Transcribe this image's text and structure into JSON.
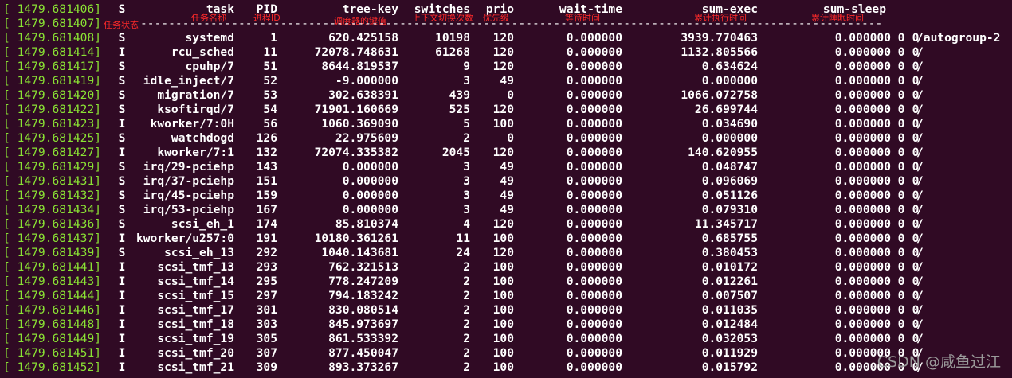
{
  "theme": {
    "background": "#300a24",
    "foreground": "#ffffff",
    "timestamp_color": "#8ae234",
    "annotation_color": "#ff2a2a",
    "watermark_color": "#9a9a9a"
  },
  "header": {
    "timestamp": "1479.681406",
    "columns": {
      "s": "S",
      "task": "task",
      "pid": "PID",
      "tree_key": "tree-key",
      "switches": "switches",
      "prio": "prio",
      "wait_time": "wait-time",
      "sum_exec": "sum-exec",
      "sum_sleep": "sum-sleep"
    }
  },
  "separator": {
    "timestamp": "1479.681407",
    "dashes": "--------------------------------------------------------------------------------------------------------------"
  },
  "annotations": {
    "s": "任务状态",
    "task": "任务名称",
    "pid": "进程ID",
    "tree_key": "调度器的键值",
    "switches": "上下文切换次数",
    "prio": "优先级",
    "wait_time": "等待时间",
    "sum_exec": "累计执行时间",
    "sum_sleep": "累计睡眠时间"
  },
  "rows": [
    {
      "ts": "1479.681408",
      "s": "S",
      "task": "systemd",
      "pid": "1",
      "tree_key": "620.425158",
      "switches": "10198",
      "prio": "120",
      "wait": "0.000000",
      "exec": "3939.770463",
      "sleep": "0.000000",
      "z1": "0",
      "z2": "0",
      "group": "/autogroup-2"
    },
    {
      "ts": "1479.681414",
      "s": "I",
      "task": "rcu_sched",
      "pid": "11",
      "tree_key": "72078.748631",
      "switches": "61268",
      "prio": "120",
      "wait": "0.000000",
      "exec": "1132.805566",
      "sleep": "0.000000",
      "z1": "0",
      "z2": "0",
      "group": "/"
    },
    {
      "ts": "1479.681417",
      "s": "S",
      "task": "cpuhp/7",
      "pid": "51",
      "tree_key": "8644.819537",
      "switches": "9",
      "prio": "120",
      "wait": "0.000000",
      "exec": "0.634624",
      "sleep": "0.000000",
      "z1": "0",
      "z2": "0",
      "group": "/"
    },
    {
      "ts": "1479.681419",
      "s": "S",
      "task": "idle_inject/7",
      "pid": "52",
      "tree_key": "-9.000000",
      "switches": "3",
      "prio": "49",
      "wait": "0.000000",
      "exec": "0.000000",
      "sleep": "0.000000",
      "z1": "0",
      "z2": "0",
      "group": "/"
    },
    {
      "ts": "1479.681420",
      "s": "S",
      "task": "migration/7",
      "pid": "53",
      "tree_key": "302.638391",
      "switches": "439",
      "prio": "0",
      "wait": "0.000000",
      "exec": "1066.072758",
      "sleep": "0.000000",
      "z1": "0",
      "z2": "0",
      "group": "/"
    },
    {
      "ts": "1479.681422",
      "s": "S",
      "task": "ksoftirqd/7",
      "pid": "54",
      "tree_key": "71901.160669",
      "switches": "525",
      "prio": "120",
      "wait": "0.000000",
      "exec": "26.699744",
      "sleep": "0.000000",
      "z1": "0",
      "z2": "0",
      "group": "/"
    },
    {
      "ts": "1479.681423",
      "s": "I",
      "task": "kworker/7:0H",
      "pid": "56",
      "tree_key": "1060.369090",
      "switches": "5",
      "prio": "100",
      "wait": "0.000000",
      "exec": "0.034690",
      "sleep": "0.000000",
      "z1": "0",
      "z2": "0",
      "group": "/"
    },
    {
      "ts": "1479.681425",
      "s": "S",
      "task": "watchdogd",
      "pid": "126",
      "tree_key": "22.975609",
      "switches": "2",
      "prio": "0",
      "wait": "0.000000",
      "exec": "0.000000",
      "sleep": "0.000000",
      "z1": "0",
      "z2": "0",
      "group": "/"
    },
    {
      "ts": "1479.681427",
      "s": "I",
      "task": "kworker/7:1",
      "pid": "132",
      "tree_key": "72074.335382",
      "switches": "2045",
      "prio": "120",
      "wait": "0.000000",
      "exec": "140.620955",
      "sleep": "0.000000",
      "z1": "0",
      "z2": "0",
      "group": "/"
    },
    {
      "ts": "1479.681429",
      "s": "S",
      "task": "irq/29-pciehp",
      "pid": "143",
      "tree_key": "0.000000",
      "switches": "3",
      "prio": "49",
      "wait": "0.000000",
      "exec": "0.048747",
      "sleep": "0.000000",
      "z1": "0",
      "z2": "0",
      "group": "/"
    },
    {
      "ts": "1479.681431",
      "s": "S",
      "task": "irq/37-pciehp",
      "pid": "151",
      "tree_key": "0.000000",
      "switches": "3",
      "prio": "49",
      "wait": "0.000000",
      "exec": "0.096069",
      "sleep": "0.000000",
      "z1": "0",
      "z2": "0",
      "group": "/"
    },
    {
      "ts": "1479.681432",
      "s": "S",
      "task": "irq/45-pciehp",
      "pid": "159",
      "tree_key": "0.000000",
      "switches": "3",
      "prio": "49",
      "wait": "0.000000",
      "exec": "0.051126",
      "sleep": "0.000000",
      "z1": "0",
      "z2": "0",
      "group": "/"
    },
    {
      "ts": "1479.681434",
      "s": "S",
      "task": "irq/53-pciehp",
      "pid": "167",
      "tree_key": "0.000000",
      "switches": "3",
      "prio": "49",
      "wait": "0.000000",
      "exec": "0.079310",
      "sleep": "0.000000",
      "z1": "0",
      "z2": "0",
      "group": "/"
    },
    {
      "ts": "1479.681436",
      "s": "S",
      "task": "scsi_eh_1",
      "pid": "174",
      "tree_key": "85.810374",
      "switches": "4",
      "prio": "120",
      "wait": "0.000000",
      "exec": "11.345717",
      "sleep": "0.000000",
      "z1": "0",
      "z2": "0",
      "group": "/"
    },
    {
      "ts": "1479.681437",
      "s": "I",
      "task": "kworker/u257:0",
      "pid": "191",
      "tree_key": "10180.361261",
      "switches": "11",
      "prio": "100",
      "wait": "0.000000",
      "exec": "0.685755",
      "sleep": "0.000000",
      "z1": "0",
      "z2": "0",
      "group": "/"
    },
    {
      "ts": "1479.681439",
      "s": "S",
      "task": "scsi_eh_13",
      "pid": "292",
      "tree_key": "1040.143681",
      "switches": "24",
      "prio": "120",
      "wait": "0.000000",
      "exec": "0.380453",
      "sleep": "0.000000",
      "z1": "0",
      "z2": "0",
      "group": "/"
    },
    {
      "ts": "1479.681441",
      "s": "I",
      "task": "scsi_tmf_13",
      "pid": "293",
      "tree_key": "762.321513",
      "switches": "2",
      "prio": "100",
      "wait": "0.000000",
      "exec": "0.010172",
      "sleep": "0.000000",
      "z1": "0",
      "z2": "0",
      "group": "/"
    },
    {
      "ts": "1479.681443",
      "s": "I",
      "task": "scsi_tmf_14",
      "pid": "295",
      "tree_key": "778.247209",
      "switches": "2",
      "prio": "100",
      "wait": "0.000000",
      "exec": "0.012261",
      "sleep": "0.000000",
      "z1": "0",
      "z2": "0",
      "group": "/"
    },
    {
      "ts": "1479.681444",
      "s": "I",
      "task": "scsi_tmf_15",
      "pid": "297",
      "tree_key": "794.183242",
      "switches": "2",
      "prio": "100",
      "wait": "0.000000",
      "exec": "0.007507",
      "sleep": "0.000000",
      "z1": "0",
      "z2": "0",
      "group": "/"
    },
    {
      "ts": "1479.681446",
      "s": "I",
      "task": "scsi_tmf_17",
      "pid": "301",
      "tree_key": "830.080514",
      "switches": "2",
      "prio": "100",
      "wait": "0.000000",
      "exec": "0.011035",
      "sleep": "0.000000",
      "z1": "0",
      "z2": "0",
      "group": "/"
    },
    {
      "ts": "1479.681448",
      "s": "I",
      "task": "scsi_tmf_18",
      "pid": "303",
      "tree_key": "845.973697",
      "switches": "2",
      "prio": "100",
      "wait": "0.000000",
      "exec": "0.012484",
      "sleep": "0.000000",
      "z1": "0",
      "z2": "0",
      "group": "/"
    },
    {
      "ts": "1479.681449",
      "s": "I",
      "task": "scsi_tmf_19",
      "pid": "305",
      "tree_key": "861.533392",
      "switches": "2",
      "prio": "100",
      "wait": "0.000000",
      "exec": "0.032053",
      "sleep": "0.000000",
      "z1": "0",
      "z2": "0",
      "group": "/"
    },
    {
      "ts": "1479.681451",
      "s": "I",
      "task": "scsi_tmf_20",
      "pid": "307",
      "tree_key": "877.450047",
      "switches": "2",
      "prio": "100",
      "wait": "0.000000",
      "exec": "0.011929",
      "sleep": "0.000000",
      "z1": "0",
      "z2": "0",
      "group": "/"
    },
    {
      "ts": "1479.681452",
      "s": "I",
      "task": "scsi_tmf_21",
      "pid": "309",
      "tree_key": "893.373267",
      "switches": "2",
      "prio": "100",
      "wait": "0.000000",
      "exec": "0.015792",
      "sleep": "0.000000",
      "z1": "0",
      "z2": "0",
      "group": "/"
    }
  ],
  "watermark": "CSDN @咸鱼过江"
}
